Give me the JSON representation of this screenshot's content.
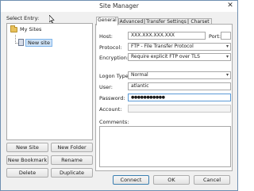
{
  "window": {
    "title": "Site Manager",
    "close_glyph": "✕"
  },
  "left": {
    "select_entry_label": "Select Entry:",
    "tree": {
      "root_label": "My Sites",
      "root_icon": "folder-icon",
      "child_label": "New site",
      "child_icon": "site-icon"
    },
    "buttons": {
      "new_site": "New Site",
      "new_folder": "New Folder",
      "new_bookmark": "New Bookmark",
      "rename": "Rename",
      "delete": "Delete",
      "duplicate": "Duplicate"
    }
  },
  "tabs": [
    {
      "label": "General",
      "active": true
    },
    {
      "label": "Advanced",
      "active": false
    },
    {
      "label": "Transfer Settings",
      "active": false
    },
    {
      "label": "Charset",
      "active": false
    }
  ],
  "general": {
    "host_label": "Host:",
    "host_value": "XXX.XXX.XXX.XXX",
    "port_label": "Port:",
    "port_value": "",
    "protocol_label": "Protocol:",
    "protocol_value": "FTP - File Transfer Protocol",
    "encryption_label": "Encryption:",
    "encryption_value": "Require explicit FTP over TLS",
    "logon_type_label": "Logon Type:",
    "logon_type_value": "Normal",
    "user_label": "User:",
    "user_value": "atlantic",
    "password_label": "Password:",
    "password_value": "●●●●●●●●●●●",
    "account_label": "Account:",
    "account_value": "",
    "comments_label": "Comments:",
    "comments_value": ""
  },
  "footer": {
    "connect": "Connect",
    "ok": "OK",
    "cancel": "Cancel"
  },
  "icons": {
    "dropdown": "▾"
  },
  "colors": {
    "selection": "#cfe3f7",
    "focus_border": "#5a9ad6",
    "folder": "#e8c05a"
  }
}
